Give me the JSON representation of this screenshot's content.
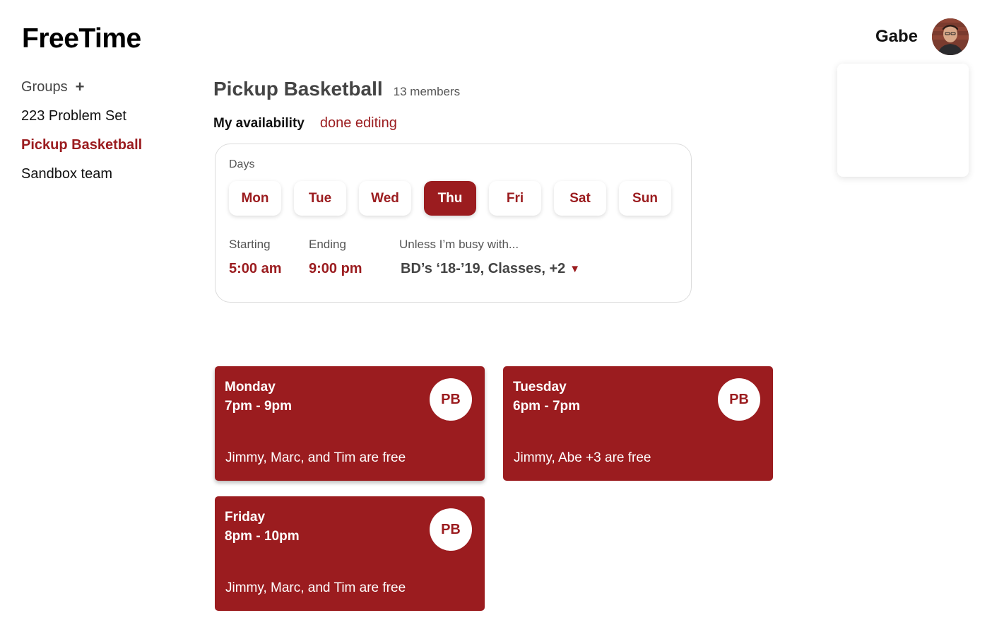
{
  "app": {
    "title": "FreeTime"
  },
  "user": {
    "name": "Gabe"
  },
  "sidebar": {
    "groups_label": "Groups",
    "add_label": "+",
    "items": [
      {
        "label": "223 Problem Set",
        "active": false
      },
      {
        "label": "Pickup Basketball",
        "active": true
      },
      {
        "label": "Sandbox team",
        "active": false
      }
    ]
  },
  "group": {
    "title": "Pickup Basketball",
    "members": "13 members"
  },
  "availability": {
    "label": "My availability",
    "done_label": "done editing",
    "days_label": "Days",
    "days": [
      {
        "label": "Mon",
        "selected": false
      },
      {
        "label": "Tue",
        "selected": false
      },
      {
        "label": "Wed",
        "selected": false
      },
      {
        "label": "Thu",
        "selected": true
      },
      {
        "label": "Fri",
        "selected": false
      },
      {
        "label": "Sat",
        "selected": false
      },
      {
        "label": "Sun",
        "selected": false
      }
    ],
    "starting_label": "Starting",
    "starting_value": "5:00 am",
    "ending_label": "Ending",
    "ending_value": "9:00 pm",
    "busy_label": "Unless I’m busy with...",
    "busy_value": "BD’s ‘18-’19, Classes, +2",
    "busy_caret": "▼"
  },
  "slots": [
    {
      "day": "Monday",
      "time": "7pm - 9pm",
      "free": "Jimmy, Marc, and Tim are free",
      "badge": "PB"
    },
    {
      "day": "Tuesday",
      "time": "6pm - 7pm",
      "free": "Jimmy, Abe +3 are free",
      "badge": "PB"
    },
    {
      "day": "Friday",
      "time": "8pm - 10pm",
      "free": "Jimmy, Marc, and Tim are free",
      "badge": "PB"
    }
  ],
  "colors": {
    "accent": "#9b1c1f"
  },
  "icons": {
    "add": "plus-icon",
    "dropdown": "caret-down-icon",
    "avatar": "user-avatar"
  }
}
